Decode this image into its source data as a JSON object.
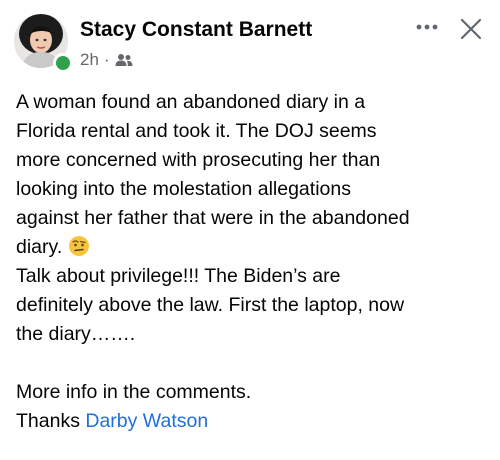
{
  "post": {
    "author_name": "Stacy Constant Barnett",
    "timestamp": "2h",
    "separator": "·",
    "audience_icon": "friends-icon",
    "more_icon": "more-options-icon",
    "close_icon": "close-icon",
    "online_status_color": "#31a24c",
    "mention_color": "#216fdb",
    "body": {
      "line_1": "A woman found an abandoned diary in a",
      "line_2": "Florida rental and took it. The DOJ seems",
      "line_3": "more concerned with prosecuting her than",
      "line_4": "looking into the molestation allegations",
      "line_5": "against her father that were in the abandoned",
      "line_6": "diary.",
      "emoji": "face-with-raised-eyebrow-emoji",
      "line_7": "Talk about privilege!!! The Biden’s are",
      "line_8": "definitely above the law.  First the laptop, now",
      "line_9": "the diary…….",
      "line_10": "More info in the comments.",
      "thanks_prefix": "Thanks ",
      "mention": "Darby Watson"
    }
  }
}
